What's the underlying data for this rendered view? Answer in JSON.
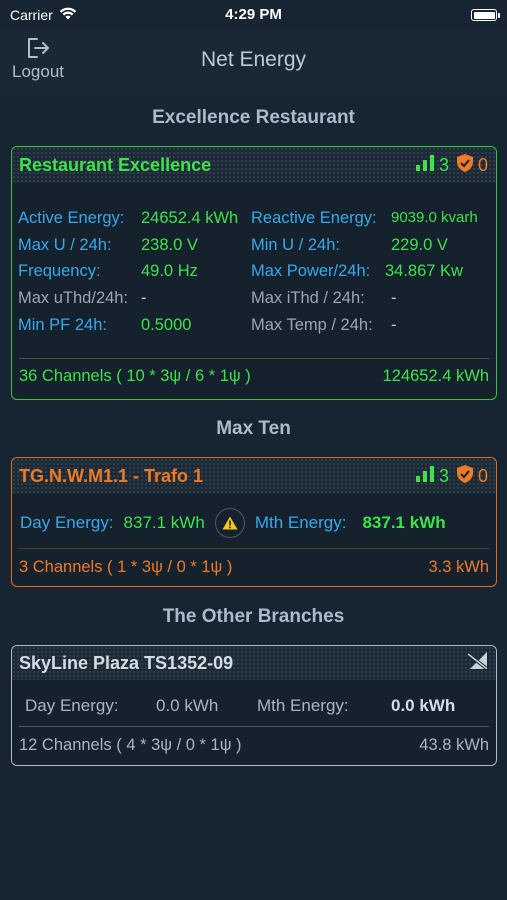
{
  "status_bar": {
    "carrier": "Carrier",
    "time": "4:29 PM"
  },
  "nav": {
    "logout_label": "Logout",
    "title": "Net Energy"
  },
  "sections": [
    {
      "title": "Excellence Restaurant"
    },
    {
      "title": "Max Ten"
    },
    {
      "title": "The Other Branches"
    }
  ],
  "card_restaurant": {
    "title": "Restaurant Excellence",
    "signal_count": "3",
    "alert_count": "0",
    "rows": [
      [
        {
          "label": "Active Energy:",
          "value": "24652.4 kWh"
        },
        {
          "label": "Reactive Energy:",
          "value": "9039.0 kvarh"
        }
      ],
      [
        {
          "label": "Max U / 24h:",
          "value": "238.0 V"
        },
        {
          "label": "Min U / 24h:",
          "value": "229.0 V"
        }
      ],
      [
        {
          "label": "Frequency:",
          "value": "49.0 Hz"
        },
        {
          "label": "Max Power/24h:",
          "value": "34.867 Kw"
        }
      ],
      [
        {
          "label": "Max uThd/24h:",
          "value": "-"
        },
        {
          "label": "Max iThd / 24h:",
          "value": "-"
        }
      ],
      [
        {
          "label": "Min PF 24h:",
          "value": "0.5000"
        },
        {
          "label": "Max Temp / 24h:",
          "value": "-"
        }
      ]
    ],
    "channels": "36 Channels ( 10 * 3ψ / 6 * 1ψ )",
    "total": "124652.4 kWh"
  },
  "card_trafo": {
    "title": "TG.N.W.M1.1 - Trafo 1",
    "signal_count": "3",
    "alert_count": "0",
    "day_label": "Day Energy:",
    "day_value": "837.1 kWh",
    "mth_label": "Mth Energy:",
    "mth_value": "837.1 kWh",
    "channels": "3 Channels ( 1 * 3ψ / 0 * 1ψ )",
    "total": "3.3 kWh"
  },
  "card_skyline": {
    "title": "SkyLine Plaza TS1352-09",
    "day_label": "Day Energy:",
    "day_value": "0.0 kWh",
    "mth_label": "Mth Energy:",
    "mth_value": "0.0 kWh",
    "channels": "12 Channels ( 4 * 3ψ / 0 * 1ψ )",
    "total": "43.8 kWh"
  },
  "colors": {
    "green": "#3ee24a",
    "blue": "#38a9ec",
    "orange": "#f07a25",
    "gray": "#9aa7b2",
    "background": "#172532"
  },
  "icons": [
    "wifi-icon",
    "battery-icon",
    "logout-icon",
    "signal-bars-icon",
    "shield-check-icon",
    "warning-icon",
    "no-signal-icon"
  ]
}
